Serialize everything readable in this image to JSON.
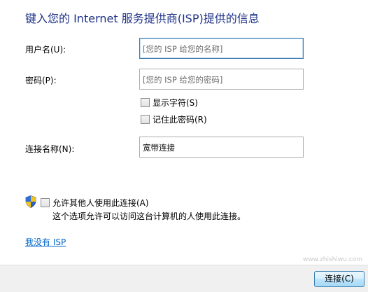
{
  "heading": "键入您的 Internet 服务提供商(ISP)提供的信息",
  "username": {
    "label": "用户名(U):",
    "placeholder": "[您的 ISP 给您的名称]"
  },
  "password": {
    "label": "密码(P):",
    "placeholder": "[您的 ISP 给您的密码]"
  },
  "show_chars": {
    "label": "显示字符(S)",
    "checked": false
  },
  "remember_password": {
    "label": "记住此密码(R)",
    "checked": false
  },
  "connection_name": {
    "label": "连接名称(N):",
    "value": "宽带连接"
  },
  "allow_others": {
    "label": "允许其他人使用此连接(A)",
    "checked": false,
    "note": "这个选项允许可以访问这台计算机的人使用此连接。"
  },
  "no_isp_link": "我没有 ISP",
  "connect_button": "连接(C)",
  "watermark": "www.zhishiwu.com",
  "colors": {
    "heading": "#1e3287",
    "link": "#0066cc",
    "footer": "#f0f0f0"
  },
  "icons": {
    "shield": "uac-shield-icon"
  }
}
